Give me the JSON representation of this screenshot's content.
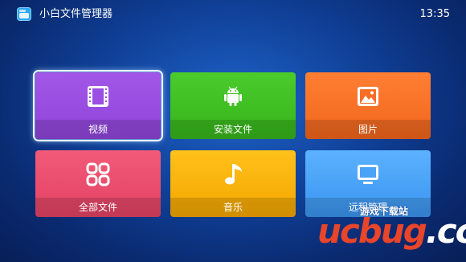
{
  "header": {
    "app_title": "小白文件管理器",
    "time": "13:35"
  },
  "tiles": [
    {
      "label": "视频",
      "icon": "film-icon",
      "focused": true
    },
    {
      "label": "安装文件",
      "icon": "android-icon"
    },
    {
      "label": "图片",
      "icon": "image-icon"
    },
    {
      "label": "全部文件",
      "icon": "grid-icon"
    },
    {
      "label": "音乐",
      "icon": "music-note-icon"
    },
    {
      "label": "远程管理",
      "icon": "monitor-icon"
    }
  ],
  "watermark": {
    "site_text": "游戏下载站",
    "logo_text": "ucbug",
    "logo_suffix": ".cc"
  },
  "colors": {
    "video": "#9b4fe3",
    "apk": "#40c024",
    "image": "#f76f27",
    "all_files": "#ec4e6e",
    "music": "#f9b30d",
    "remote": "#4aa3f7",
    "background": "#1452b4"
  }
}
